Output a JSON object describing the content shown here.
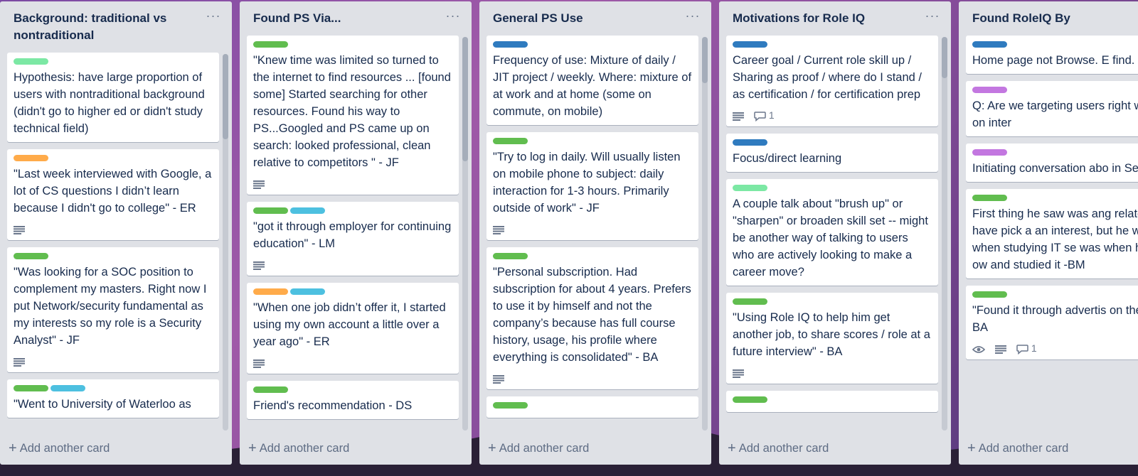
{
  "colors": {
    "green": "#61bd4f",
    "mint": "#7ce8a4",
    "orange": "#ffab4a",
    "sky": "#4dc0e0",
    "blue": "#2f7bbf",
    "purple": "#c377e0",
    "list_bg": "#dfe1e6",
    "card_bg": "#ffffff",
    "text": "#172b4d"
  },
  "board": {
    "add_card_label": "Add another card",
    "lists": [
      {
        "title": "Background: traditional vs nontraditional",
        "cards": [
          {
            "labels": [
              "mint"
            ],
            "text": "Hypothesis: have large proportion of users with nontraditional background (didn't go to higher ed or didn't study technical field)",
            "description": false
          },
          {
            "labels": [
              "orange"
            ],
            "text": "\"Last week interviewed with Google, a lot of CS questions I didn’t learn because I didn't go to college\" - ER",
            "description": true
          },
          {
            "labels": [
              "green"
            ],
            "text": "\"Was looking for a SOC position to complement my masters. Right now I put Network/security fundamental as my interests so my role is a Security Analyst\" - JF",
            "description": true
          },
          {
            "labels": [
              "green",
              "sky"
            ],
            "text": "\"Went to University of Waterloo as",
            "description": false
          }
        ]
      },
      {
        "title": "Found PS Via...",
        "cards": [
          {
            "labels": [
              "green"
            ],
            "text": "\"Knew time was limited so turned to the internet to find resources ... [found some] Started searching for other resources. Found his way to PS...Googled and PS came up on search: looked professional, clean relative to competitors \" - JF",
            "description": true
          },
          {
            "labels": [
              "green",
              "sky"
            ],
            "text": "\"got it through employer for continuing education\" - LM",
            "description": true
          },
          {
            "labels": [
              "orange",
              "sky"
            ],
            "text": "\"When one job didn’t offer it, I started using my own account a little over a year ago\" - ER",
            "description": true
          },
          {
            "labels": [
              "green"
            ],
            "text": "Friend's recommendation - DS",
            "description": false
          }
        ]
      },
      {
        "title": "General PS Use",
        "cards": [
          {
            "labels": [
              "blue"
            ],
            "text": "Frequency of use: Mixture of daily / JIT project / weekly. Where: mixture of at work and at home (some on commute, on mobile)",
            "description": false
          },
          {
            "labels": [
              "green"
            ],
            "text": "\"Try to log in daily. Will usually listen on mobile phone to subject: daily interaction for 1-3 hours. Primarily outside of work\" - JF",
            "description": true
          },
          {
            "labels": [
              "green"
            ],
            "text": "\"Personal subscription. Had subscription for about 4 years. Prefers to use it by himself and not the company’s because has full course history, usage, his profile where everything is consolidated\" - BA",
            "description": true
          },
          {
            "labels": [
              "green"
            ],
            "text": "",
            "description": false
          }
        ]
      },
      {
        "title": "Motivations for Role IQ",
        "cards": [
          {
            "labels": [
              "blue"
            ],
            "text": "Career goal / Current role skill up / Sharing as proof / where do I stand / as certification / for certification prep",
            "description": true,
            "comments": "1"
          },
          {
            "labels": [
              "blue"
            ],
            "text": "Focus/direct learning",
            "description": false
          },
          {
            "labels": [
              "mint"
            ],
            "text": "A couple talk about \"brush up\" or \"sharpen\" or broaden skill set -- might be another way of talking to users who are actively looking to make a career move?",
            "description": false
          },
          {
            "labels": [
              "green"
            ],
            "text": "\"Using Role IQ to help him get another job, to share scores / role at a future interview\" - BA",
            "description": true
          },
          {
            "labels": [
              "green"
            ],
            "text": "",
            "description": false
          }
        ]
      },
      {
        "title": "Found RoleIQ By",
        "cards": [
          {
            "labels": [
              "blue"
            ],
            "text": "Home page not Browse. E find.",
            "description": false
          },
          {
            "labels": [
              "purple"
            ],
            "text": "Q: Are we targeting users right way? (based on inter",
            "description": false
          },
          {
            "labels": [
              "purple"
            ],
            "text": "Initiating conversation abo in Search?",
            "description": false
          },
          {
            "labels": [
              "green"
            ],
            "text": "First thing he saw was ang related (might have pick a an interest, but he works i Later, when studying IT se was when he picked his ow and studied it -BM",
            "description": false
          },
          {
            "labels": [
              "green"
            ],
            "text": "\"Found it through advertis on the front page\" - BA",
            "description": true,
            "watch": true,
            "comments": "1"
          }
        ]
      }
    ]
  }
}
